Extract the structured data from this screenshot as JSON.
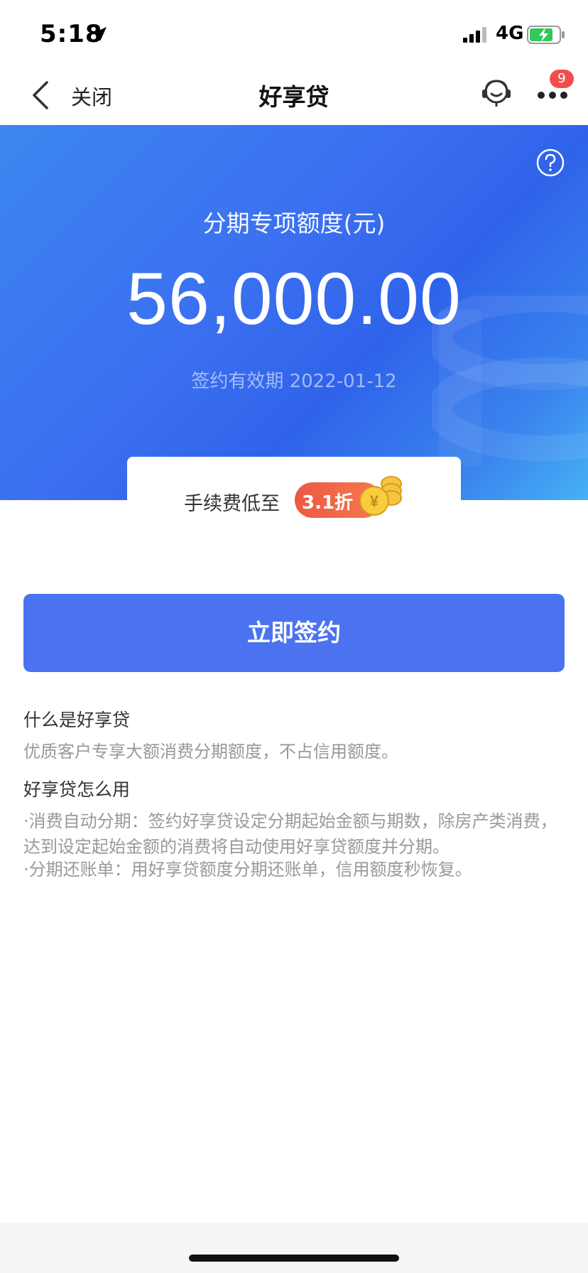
{
  "status": {
    "time": "5:18",
    "network": "4G"
  },
  "nav": {
    "close_label": "关闭",
    "title": "好享贷",
    "badge_count": "9"
  },
  "hero": {
    "label": "分期专项额度(元)",
    "amount": "56,000.00",
    "valid_until": "签约有效期 2022-01-12"
  },
  "fee": {
    "text": "手续费低至",
    "discount": "3.1折"
  },
  "actions": {
    "sign_label": "立即签约"
  },
  "info": {
    "q1": "什么是好享贷",
    "a1": "优质客户专享大额消费分期额度，不占信用额度。",
    "q2": "好享贷怎么用",
    "a2_1": "·消费自动分期：签约好享贷设定分期起始金额与期数，除房产类消费，达到设定起始金额的消费将自动使用好享贷额度并分期。",
    "a2_2": "·分期还账单：用好享贷额度分期还账单，信用额度秒恢复。"
  },
  "colors": {
    "primary": "#4b73f0",
    "badge": "#f24d4d",
    "discount": "#ee5744"
  }
}
